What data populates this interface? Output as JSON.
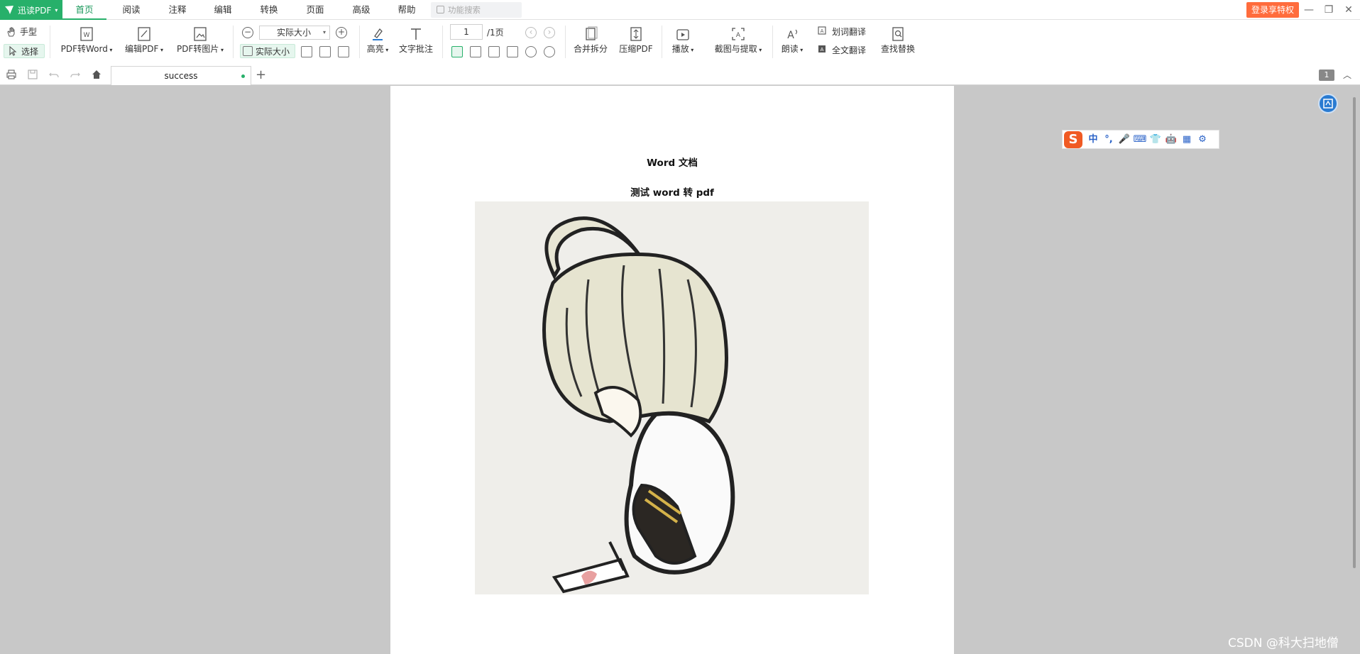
{
  "app": {
    "name": "迅读PDF"
  },
  "menu": {
    "tabs": [
      "首页",
      "阅读",
      "注释",
      "编辑",
      "转换",
      "页面",
      "高级",
      "帮助"
    ],
    "active_index": 0,
    "search_placeholder": "功能搜索",
    "login_label": "登录享特权"
  },
  "window_controls": {
    "minimize": "—",
    "restore": "❐",
    "close": "✕"
  },
  "toolbar": {
    "hand": "手型",
    "select": "选择",
    "pdf_to_word": "PDF转Word",
    "edit_pdf": "编辑PDF",
    "pdf_to_image": "PDF转图片",
    "zoom_value": "实际大小",
    "actual_size": "实际大小",
    "highlight": "高亮",
    "text_annotation": "文字批注",
    "page_current": "1",
    "page_total": "/1页",
    "merge_split": "合并拆分",
    "compress": "压缩PDF",
    "play": "播放",
    "screenshot_extract": "截图与提取",
    "read_aloud": "朗读",
    "word_translate": "划词翻译",
    "full_translate": "全文翻译",
    "find_replace": "查找替换"
  },
  "tabs": {
    "document_tab": "success",
    "add": "+",
    "page_badge": "1"
  },
  "document": {
    "title": "Word  文档",
    "subtitle": "测试 word 转 pdf"
  },
  "ime": {
    "items": [
      "中",
      "°,",
      "🎤",
      "⌨",
      "👕",
      "🤖",
      "▦",
      "⚙"
    ]
  },
  "watermark": "CSDN @科大扫地僧",
  "colors": {
    "accent": "#27b06a",
    "login": "#ff6c3c",
    "ime": "#f05a23"
  }
}
